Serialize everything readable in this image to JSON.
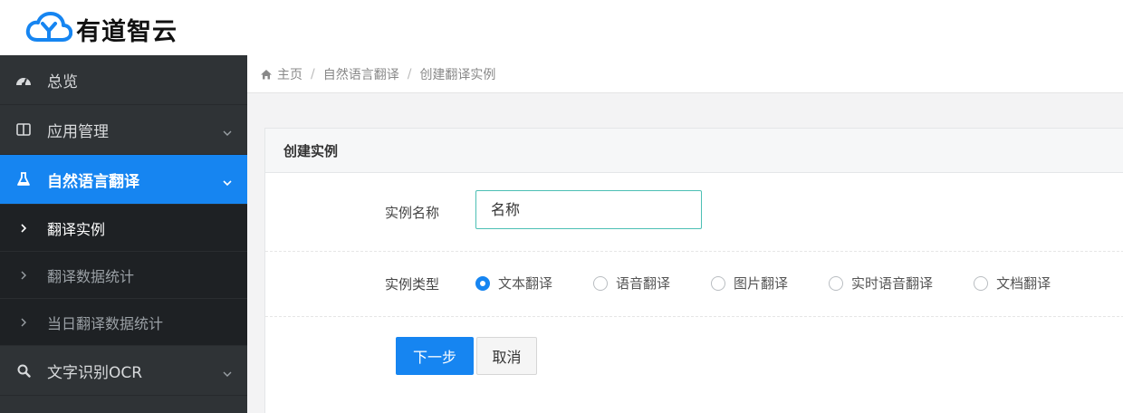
{
  "brand": {
    "name": "有道智云"
  },
  "sidebar": {
    "items": [
      {
        "label": "总览",
        "icon": "dashboard-icon"
      },
      {
        "label": "应用管理",
        "icon": "columns-icon"
      },
      {
        "label": "自然语言翻译",
        "icon": "flask-icon",
        "active": true,
        "children": [
          {
            "label": "翻译实例",
            "current": true
          },
          {
            "label": "翻译数据统计"
          },
          {
            "label": "当日翻译数据统计"
          }
        ]
      },
      {
        "label": "文字识别OCR",
        "icon": "search-icon"
      }
    ]
  },
  "breadcrumb": {
    "home": "主页",
    "section": "自然语言翻译",
    "current": "创建翻译实例",
    "separator": "/"
  },
  "form": {
    "title": "创建实例",
    "name_label": "实例名称",
    "name_placeholder": "名称",
    "type_label": "实例类型",
    "types": [
      "文本翻译",
      "语音翻译",
      "图片翻译",
      "实时语音翻译",
      "文档翻译"
    ],
    "selected_type": "文本翻译",
    "next_label": "下一步",
    "cancel_label": "取消"
  },
  "colors": {
    "accent": "#1685f1",
    "sidebar_bg": "#2f3336",
    "submenu_bg": "#1e2124",
    "input_border": "#4cbfb4"
  }
}
